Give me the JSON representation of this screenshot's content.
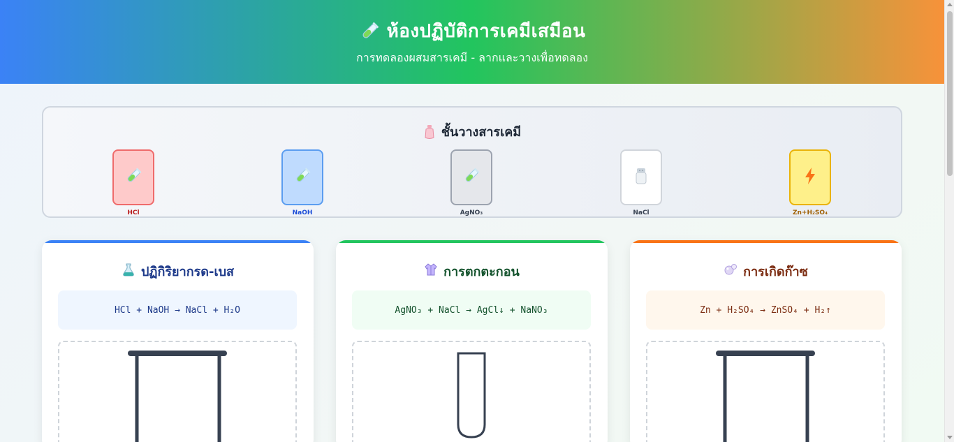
{
  "header": {
    "title": "ห้องปฏิบัติการเคมีเสมือน",
    "subtitle": "การทดลองผสมสารเคมี - ลากและวางเพื่อทดลอง",
    "icon": "test-tube-icon"
  },
  "shelf": {
    "title": "ชั้นวางสารเคมี",
    "icon": "bottle-icon",
    "chemicals": [
      {
        "label": "HCl",
        "icon": "test-tube-icon",
        "bg": "#fecaca",
        "border": "#ef6b6b",
        "text": "#b91c1c"
      },
      {
        "label": "NaOH",
        "icon": "test-tube-icon",
        "bg": "#bfdbfe",
        "border": "#5b9df0",
        "text": "#1d4ed8"
      },
      {
        "label": "AgNO₃",
        "icon": "test-tube-icon",
        "bg": "#e5e7eb",
        "border": "#9ca3af",
        "text": "#374151"
      },
      {
        "label": "NaCl",
        "icon": "salt-shaker-icon",
        "bg": "#ffffff",
        "border": "#d1d5db",
        "text": "#374151"
      },
      {
        "label": "Zn+H₂SO₄",
        "icon": "lightning-icon",
        "bg": "#fef08a",
        "border": "#eab308",
        "text": "#a16207"
      }
    ]
  },
  "experiments": [
    {
      "title": "ปฏิกิริยากรด-เบส",
      "icon": "alembic-icon",
      "equation": "HCl + NaOH → NaCl + H₂O",
      "accent": "#3b82f6",
      "title_color": "#1e3a8a",
      "eq_bg": "#eff6ff",
      "eq_color": "#1e3a8a",
      "vessel": "beaker"
    },
    {
      "title": "การตกตะกอน",
      "icon": "lab-coat-icon",
      "equation": "AgNO₃ + NaCl → AgCl↓ + NaNO₃",
      "accent": "#22c55e",
      "title_color": "#14532d",
      "eq_bg": "#f0fdf4",
      "eq_color": "#14532d",
      "vessel": "test-tube"
    },
    {
      "title": "การเกิดก๊าซ",
      "icon": "bubbles-icon",
      "equation": "Zn + H₂SO₄ → ZnSO₄ + H₂↑",
      "accent": "#f97316",
      "title_color": "#7c2d12",
      "eq_bg": "#fff7ed",
      "eq_color": "#7c2d12",
      "vessel": "beaker"
    }
  ]
}
